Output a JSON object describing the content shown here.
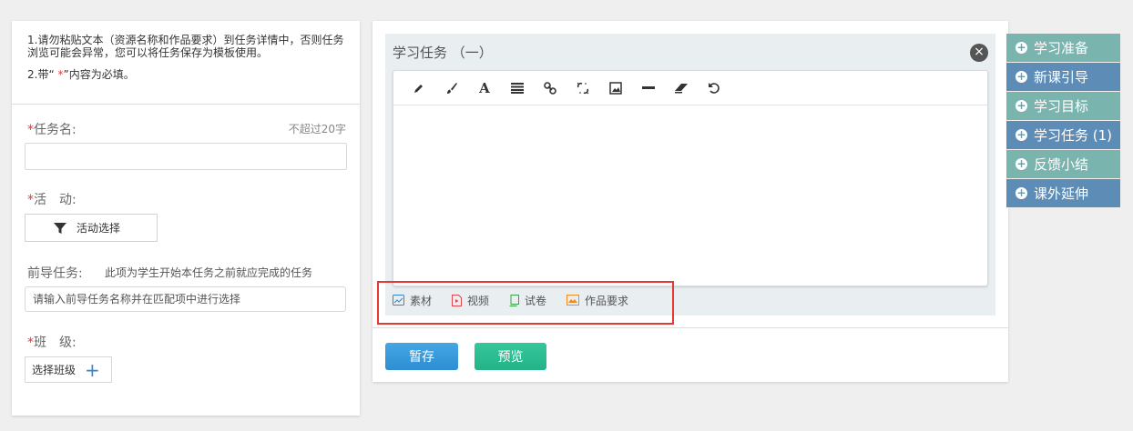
{
  "notice": {
    "line1": "1.请勿粘贴文本（资源名称和作品要求）到任务详情中，否则任务浏览可能会异常，您可以将任务保存为模板使用。",
    "line2_prefix": "2.带“ ",
    "line2_star": "*",
    "line2_suffix": "”内容为必填。"
  },
  "form": {
    "required_mark": "*",
    "task_name_label": "任务名:",
    "task_name_hint": "不超过20字",
    "task_name_value": "",
    "activity_label": "活　动:",
    "activity_button": "活动选择",
    "prior_label": "前导任务:",
    "prior_hint": "此项为学生开始本任务之前就应完成的任务",
    "prior_placeholder": "请输入前导任务名称并在匹配项中进行选择",
    "class_label": "班　级:",
    "class_button": "选择班级",
    "class_plus": "+"
  },
  "task": {
    "title": "学习任务 （一）",
    "close": "×",
    "toolbar": [
      "pencil-icon",
      "brush-icon",
      "font-icon",
      "align-icon",
      "link-icon",
      "unlink-icon",
      "image-icon",
      "horizontal-rule-icon",
      "eraser-icon",
      "undo-icon"
    ],
    "attachments": [
      {
        "label": "素材",
        "color": "#2e86d4"
      },
      {
        "label": "视频",
        "color": "#e0464f"
      },
      {
        "label": "试卷",
        "color": "#3aa34a"
      },
      {
        "label": "作品要求",
        "color": "#f08a24"
      }
    ]
  },
  "actions": {
    "save": "暂存",
    "preview": "预览"
  },
  "side_nav": [
    {
      "label": "学习准备"
    },
    {
      "label": "新课引导"
    },
    {
      "label": "学习目标"
    },
    {
      "label": "学习任务 (1)"
    },
    {
      "label": "反馈小结"
    },
    {
      "label": "课外延伸"
    }
  ],
  "colors": {
    "side_a": "#7ab4ae",
    "side_b": "#5d8db7",
    "highlight": "#e53935",
    "primary": "#2d8fd2",
    "success": "#23b387"
  }
}
